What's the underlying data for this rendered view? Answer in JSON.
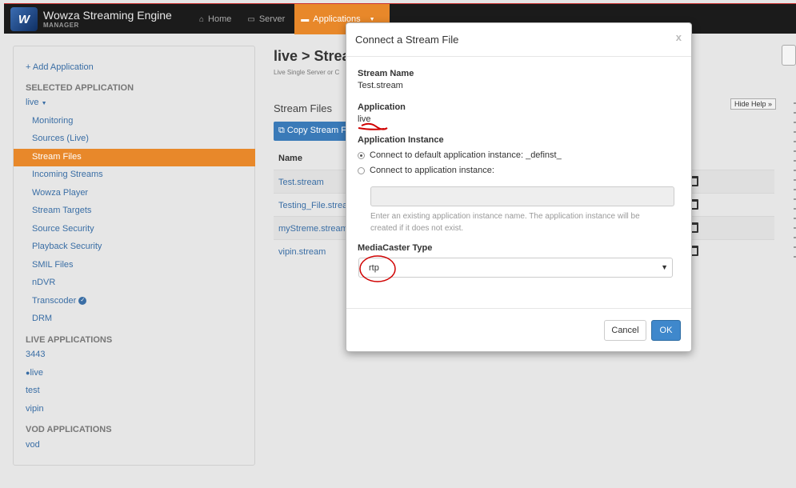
{
  "brand": {
    "name": "Wowza Streaming Engine",
    "sub": "MANAGER"
  },
  "nav": [
    {
      "label": "Home",
      "icon": "home-icon"
    },
    {
      "label": "Server",
      "icon": "monitor-icon"
    },
    {
      "label": "Applications",
      "icon": "folder-icon"
    }
  ],
  "sidebar": {
    "add": "Add Application",
    "selected_head": "SELECTED APPLICATION",
    "selected_app": "live",
    "sub_items": [
      "Monitoring",
      "Sources (Live)",
      "Stream Files",
      "Incoming Streams",
      "Wowza Player",
      "Stream Targets",
      "Source Security",
      "Playback Security",
      "SMIL Files",
      "nDVR",
      "Transcoder",
      "DRM"
    ],
    "live_head": "LIVE APPLICATIONS",
    "live_apps": [
      "3443",
      "live",
      "test",
      "vipin"
    ],
    "vod_head": "VOD APPLICATIONS",
    "vod_apps": [
      "vod"
    ]
  },
  "main": {
    "title": "live > Strea",
    "subtitle": "Live Single Server or C",
    "section": "Stream Files",
    "hide_help": "Hide Help »",
    "copy_button": "Copy Stream F",
    "table_head": "Name",
    "rows": [
      "Test.stream",
      "Testing_File.strea",
      "myStreme.stream",
      "vipin.stream"
    ]
  },
  "modal": {
    "title": "Connect a Stream File",
    "close": "x",
    "stream_name_label": "Stream Name",
    "stream_name": "Test.stream",
    "application_label": "Application",
    "application": "live",
    "instance_label": "Application Instance",
    "radio_default": "Connect to default application instance: _definst_",
    "radio_custom": "Connect to application instance:",
    "instance_value": "",
    "hint": "Enter an existing application instance name. The application instance will be created if it does not exist.",
    "mediacaster_label": "MediaCaster Type",
    "mediacaster_value": "rtp",
    "cancel": "Cancel",
    "ok": "OK"
  },
  "colors": {
    "accent": "#e8882a",
    "link": "#3a6ea5",
    "primary": "#3f88cc",
    "annotation": "#d00000"
  }
}
